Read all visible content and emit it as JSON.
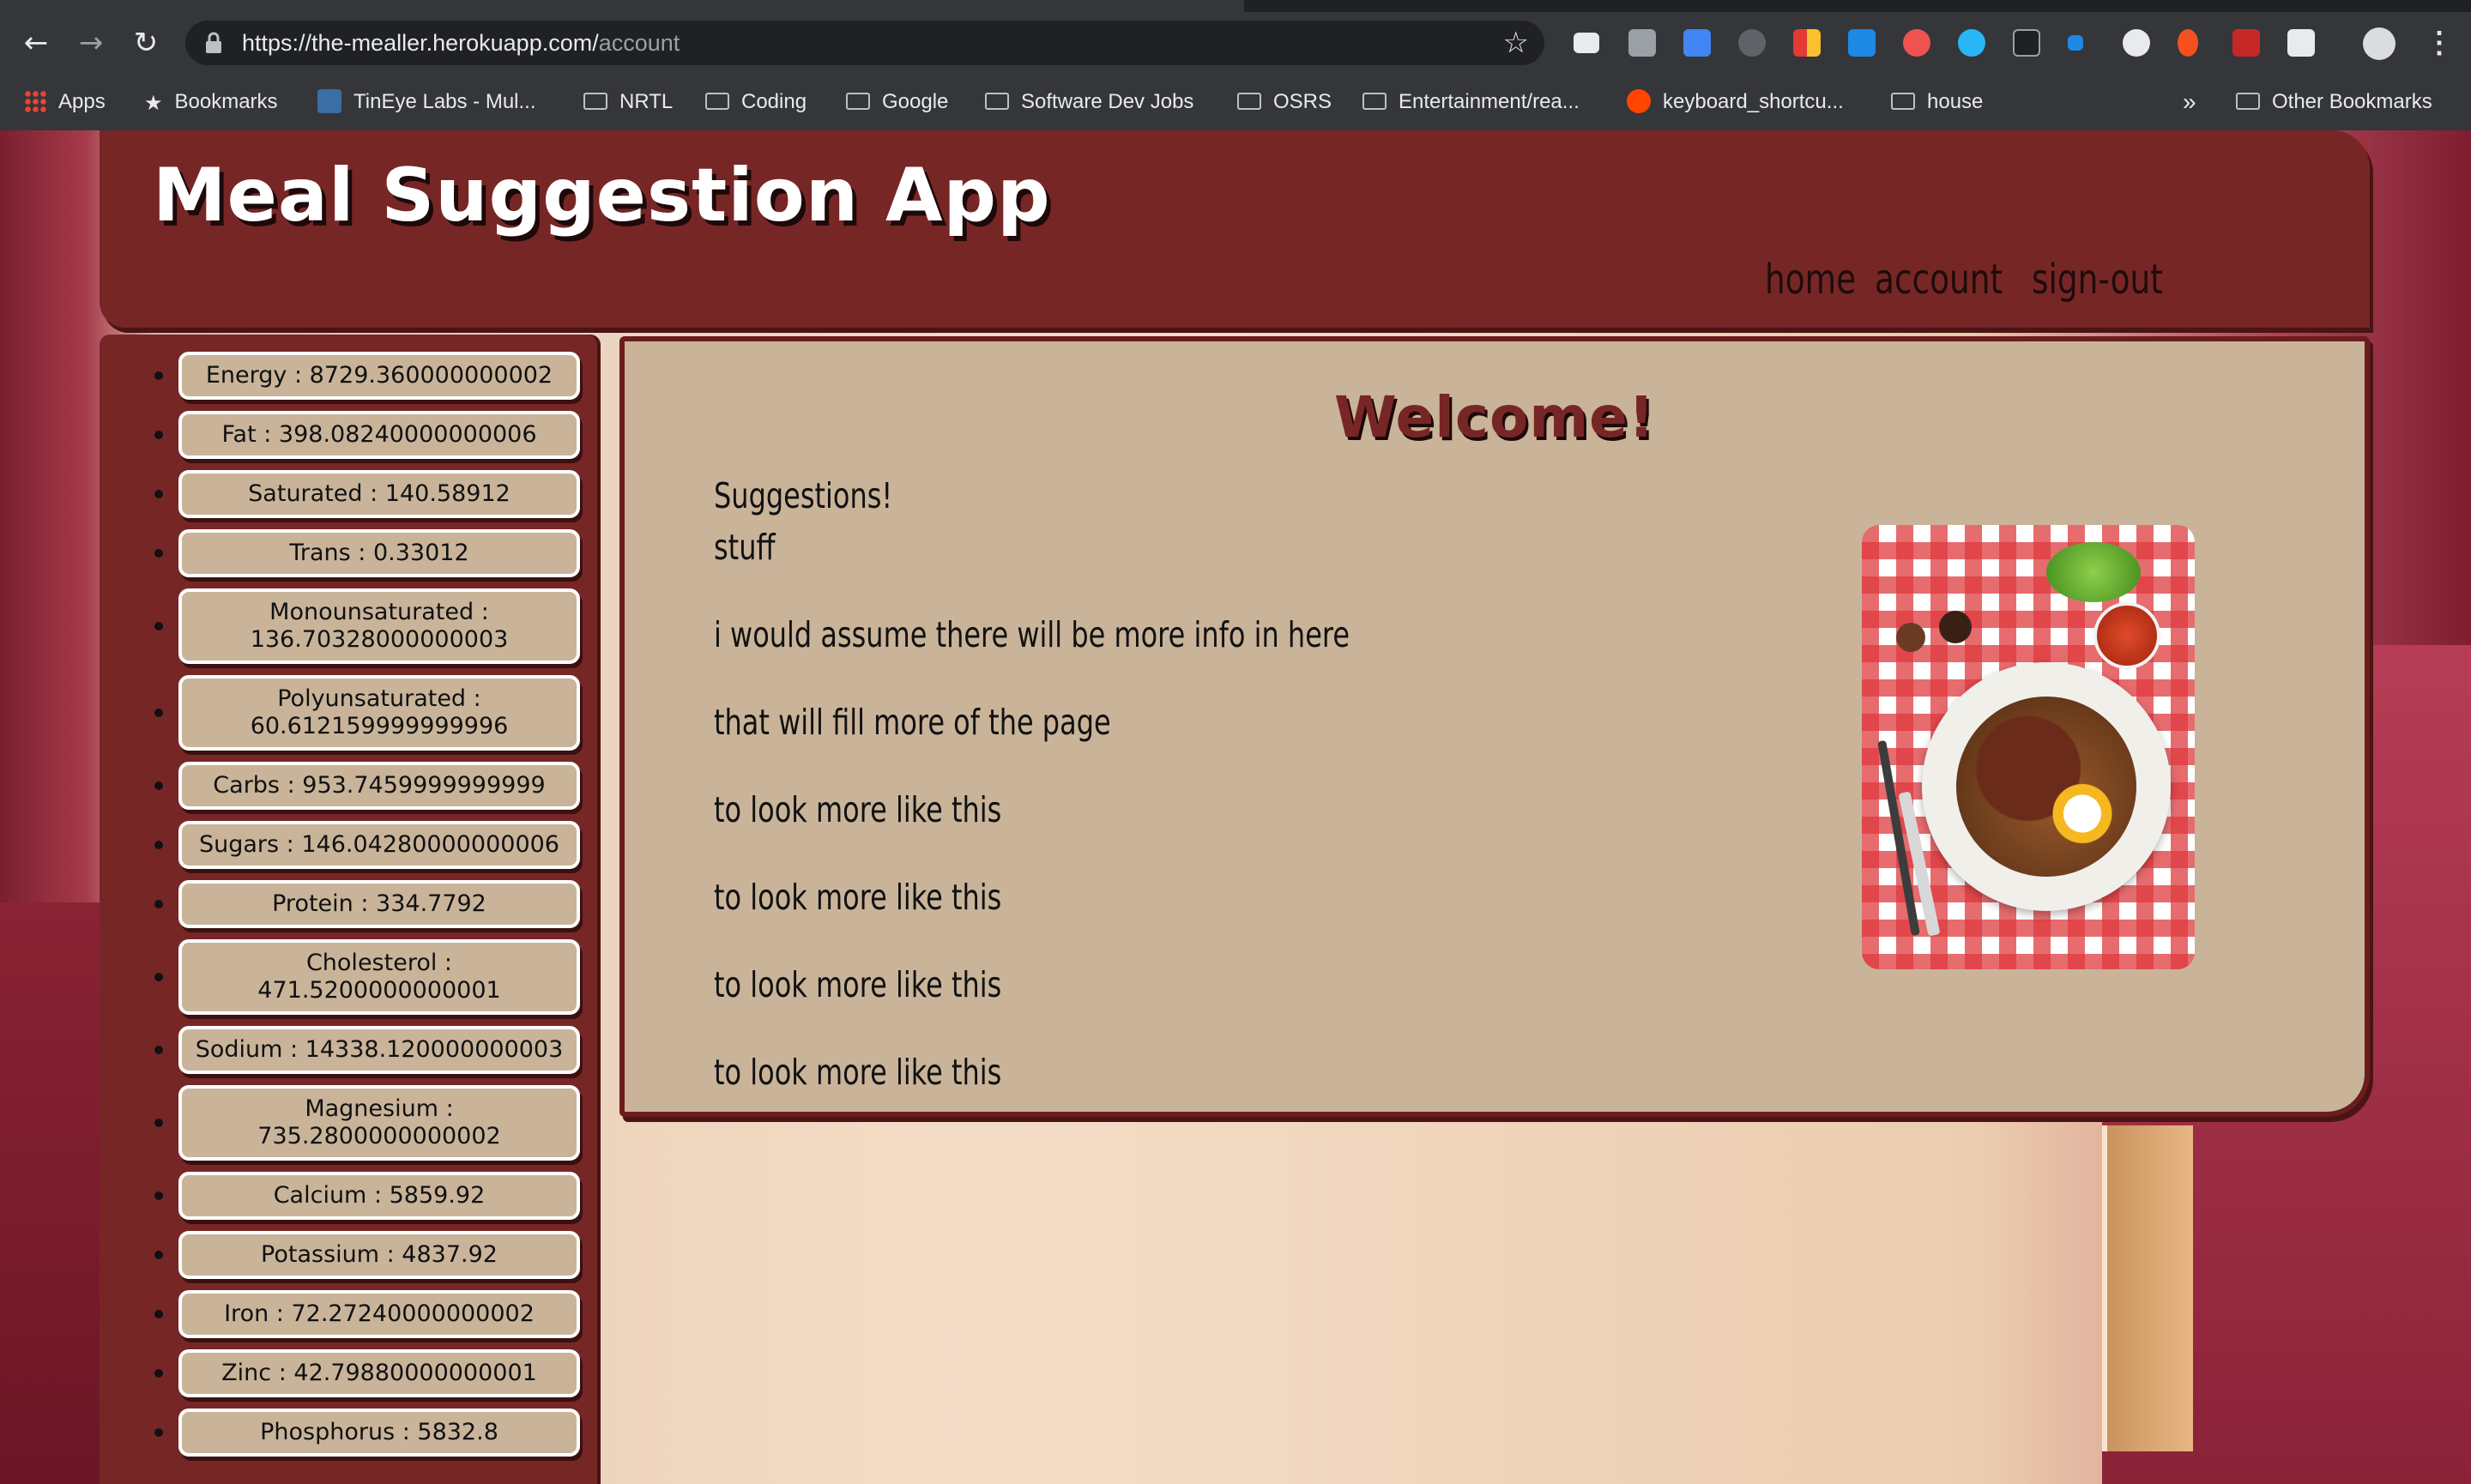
{
  "browser": {
    "url_host": "https://the-mealler.herokuapp.com/",
    "url_path": "account",
    "bookmarks": [
      {
        "label": "Apps",
        "icon": "apps-grid-icon"
      },
      {
        "label": "Bookmarks",
        "icon": "star-icon"
      },
      {
        "label": "TinEye Labs - Mul...",
        "icon": "tineye-icon"
      },
      {
        "label": "NRTL",
        "icon": "folder-icon"
      },
      {
        "label": "Coding",
        "icon": "folder-icon"
      },
      {
        "label": "Google",
        "icon": "folder-icon"
      },
      {
        "label": "Software Dev Jobs",
        "icon": "folder-icon"
      },
      {
        "label": "OSRS",
        "icon": "folder-icon"
      },
      {
        "label": "Entertainment/rea...",
        "icon": "folder-icon"
      },
      {
        "label": "keyboard_shortcu...",
        "icon": "reddit-icon"
      },
      {
        "label": "house",
        "icon": "folder-icon"
      }
    ],
    "overflow_label": "»",
    "other_bookmarks": "Other Bookmarks"
  },
  "header": {
    "title": "Meal Suggestion App",
    "nav": [
      "home",
      "account",
      "sign-out"
    ]
  },
  "nutrients": [
    "Energy : 8729.360000000002",
    "Fat : 398.08240000000006",
    "Saturated : 140.58912",
    "Trans : 0.33012",
    "Monounsaturated : 136.70328000000003",
    "Polyunsaturated : 60.612159999999996",
    "Carbs : 953.7459999999999",
    "Sugars : 146.04280000000006",
    "Protein : 334.7792",
    "Cholesterol : 471.5200000000001",
    "Sodium : 14338.120000000003",
    "Magnesium : 735.2800000000002",
    "Calcium : 5859.92",
    "Potassium : 4837.92",
    "Iron : 72.27240000000002",
    "Zinc : 42.79880000000001",
    "Phosphorus : 5832.8"
  ],
  "main": {
    "heading": "Welcome!",
    "lines": [
      "Suggestions!",
      "stuff",
      "i would assume there will be more info in here",
      "that will fill more of the page",
      "to look more like this",
      "to look more like this",
      "to look more like this",
      "to look more like this"
    ],
    "image_label": "breakfast-plate-image"
  },
  "colors": {
    "header_bg": "#772626",
    "panel_bg": "#c9b49a",
    "title_shadow": "#1d0909"
  }
}
